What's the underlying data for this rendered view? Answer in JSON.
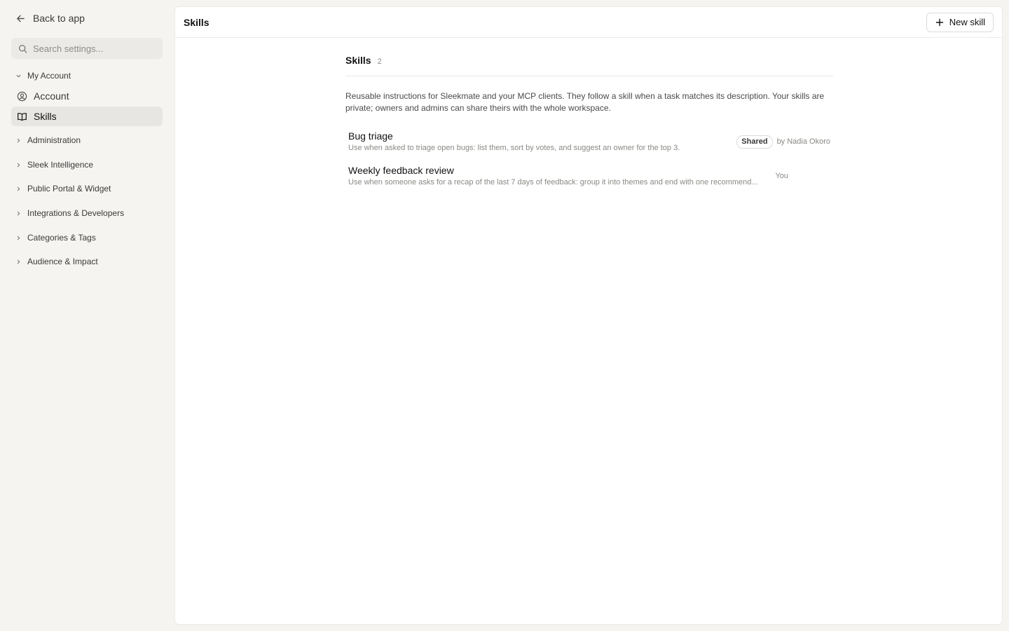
{
  "sidebar": {
    "back_label": "Back to app",
    "search_placeholder": "Search settings...",
    "groups": [
      {
        "label": "My Account",
        "expanded": true
      },
      {
        "label": "Administration"
      },
      {
        "label": "Sleek Intelligence"
      },
      {
        "label": "Public Portal & Widget"
      },
      {
        "label": "Integrations & Developers"
      },
      {
        "label": "Categories & Tags"
      },
      {
        "label": "Audience & Impact"
      }
    ],
    "items": [
      {
        "label": "Account",
        "icon": "user-circle-icon"
      },
      {
        "label": "Skills",
        "icon": "book-open-icon",
        "active": true
      }
    ]
  },
  "header": {
    "title": "Skills",
    "new_button_label": "New skill"
  },
  "section": {
    "title": "Skills",
    "count": "2",
    "description": "Reusable instructions for Sleekmate and your MCP clients. They follow a skill when a task matches its description. Your skills are private; owners and admins can share theirs with the whole workspace."
  },
  "skills": [
    {
      "name": "Bug triage",
      "description": "Use when asked to triage open bugs: list them, sort by votes, and suggest an owner for the top 3.",
      "badge": "Shared",
      "author": "by Nadia Okoro"
    },
    {
      "name": "Weekly feedback review",
      "description": "Use when someone asks for a recap of the last 7 days of feedback: group it into themes and end with one recommend...",
      "author": "You"
    }
  ],
  "colors": {
    "sidebar_bg": "#f5f4f1",
    "active_item_bg": "#e7e6e2",
    "panel_bg": "#ffffff"
  }
}
